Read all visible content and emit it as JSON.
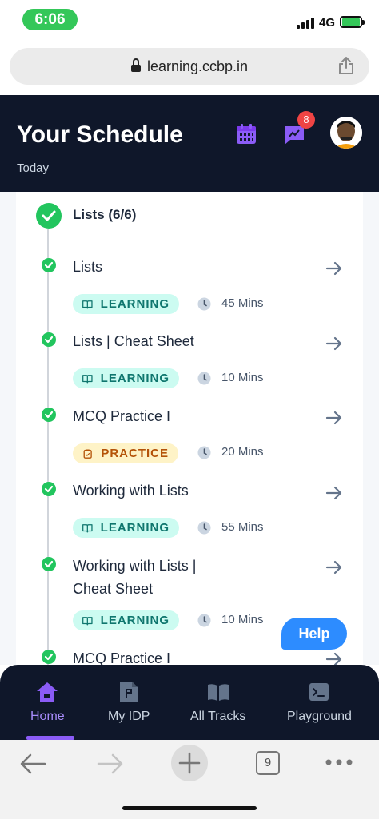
{
  "status_bar": {
    "time": "6:06",
    "network": "4G"
  },
  "browser": {
    "url": "learning.ccbp.in",
    "tab_count": "9"
  },
  "header": {
    "title": "Your Schedule",
    "subtitle": "Today",
    "notification_count": "8"
  },
  "section": {
    "title": "Lists (6/6)"
  },
  "items": [
    {
      "title": "Lists",
      "tag": "LEARNING",
      "tag_type": "learning",
      "duration": "45 Mins"
    },
    {
      "title": "Lists | Cheat Sheet",
      "tag": "LEARNING",
      "tag_type": "learning",
      "duration": "10 Mins"
    },
    {
      "title": "MCQ Practice I",
      "tag": "PRACTICE",
      "tag_type": "practice",
      "duration": "20 Mins"
    },
    {
      "title": "Working with Lists",
      "tag": "LEARNING",
      "tag_type": "learning",
      "duration": "55 Mins"
    },
    {
      "title_line1": "Working with Lists |",
      "title_line2": "Cheat Sheet",
      "tag": "LEARNING",
      "tag_type": "learning",
      "duration": "10 Mins"
    },
    {
      "title": "MCQ Practice I"
    }
  ],
  "help_label": "Help",
  "nav": [
    {
      "label": "Home",
      "icon": "home-icon",
      "active": true
    },
    {
      "label": "My IDP",
      "icon": "document-icon"
    },
    {
      "label": "All Tracks",
      "icon": "book-icon"
    },
    {
      "label": "Playground",
      "icon": "terminal-icon"
    }
  ],
  "colors": {
    "header_bg": "#0f172a",
    "accent": "#8b5cf6",
    "success": "#22c55e",
    "learning": "#0f766e",
    "practice": "#b45309"
  }
}
